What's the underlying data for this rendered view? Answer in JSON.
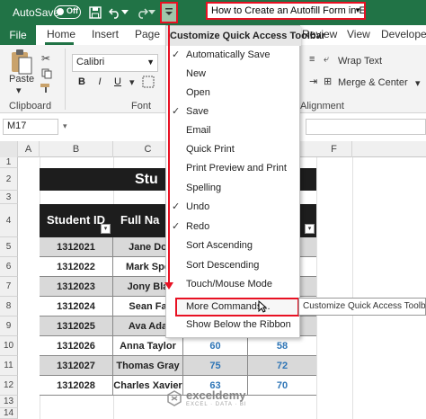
{
  "titlebar": {
    "autosave_label": "AutoSave",
    "autosave_state": "Off",
    "document_title": "How to Create an Autofill Form in Excel",
    "colors": {
      "excel_green": "#217346",
      "highlight_red": "#e81123"
    },
    "icons": [
      "save-icon",
      "undo-icon",
      "redo-icon",
      "customize-qat-icon"
    ]
  },
  "tabs": [
    "File",
    "Home",
    "Insert",
    "Page",
    "Review",
    "View",
    "Developer"
  ],
  "ribbon": {
    "paste_label": "Paste",
    "clipboard_label": "Clipboard",
    "font_name": "Calibri",
    "font_group_label": "Font",
    "bold": "B",
    "italic": "I",
    "underline": "U",
    "wrap_text": "Wrap Text",
    "merge_center": "Merge & Center",
    "alignment_label": "Alignment"
  },
  "formula_bar": {
    "name_box": "M17"
  },
  "grid": {
    "columns": [
      "A",
      "B",
      "C",
      "F"
    ],
    "rows": [
      "1",
      "2",
      "3",
      "4",
      "5",
      "6",
      "7",
      "8",
      "9",
      "10",
      "11",
      "12",
      "13",
      "14"
    ]
  },
  "table": {
    "banner": "Stu",
    "headers": [
      "Student ID",
      "Full Na"
    ],
    "rows": [
      {
        "id": "1312021",
        "name": "Jane Do",
        "s1": "",
        "s2": ""
      },
      {
        "id": "1312022",
        "name": "Mark Spe",
        "s1": "",
        "s2": ""
      },
      {
        "id": "1312023",
        "name": "Jony Bla",
        "s1": "",
        "s2": ""
      },
      {
        "id": "1312024",
        "name": "Sean Fa",
        "s1": "",
        "s2": ""
      },
      {
        "id": "1312025",
        "name": "Ava Ada",
        "s1": "",
        "s2": ""
      },
      {
        "id": "1312026",
        "name": "Anna Taylor",
        "s1": "60",
        "s2": "58"
      },
      {
        "id": "1312027",
        "name": "Thomas Gray",
        "s1": "75",
        "s2": "72"
      },
      {
        "id": "1312028",
        "name": "Charles Xavier",
        "s1": "63",
        "s2": "70"
      }
    ]
  },
  "menu": {
    "title": "Customize Quick Access Toolbar",
    "items": [
      {
        "label": "Automatically Save",
        "checked": true
      },
      {
        "label": "New",
        "checked": false
      },
      {
        "label": "Open",
        "checked": false
      },
      {
        "label": "Save",
        "checked": true
      },
      {
        "label": "Email",
        "checked": false
      },
      {
        "label": "Quick Print",
        "checked": false
      },
      {
        "label": "Print Preview and Print",
        "checked": false
      },
      {
        "label": "Spelling",
        "checked": false
      },
      {
        "label": "Undo",
        "checked": true
      },
      {
        "label": "Redo",
        "checked": true
      },
      {
        "label": "Sort Ascending",
        "checked": false
      },
      {
        "label": "Sort Descending",
        "checked": false
      },
      {
        "label": "Touch/Mouse Mode",
        "checked": false
      },
      {
        "label": "More Commands...",
        "checked": false
      },
      {
        "label": "Show Below the Ribbon",
        "checked": false
      }
    ],
    "check_glyph": "✓"
  },
  "tooltip": "Customize Quick Access Toolbar",
  "watermark": {
    "name": "exceldemy",
    "tagline": "EXCEL · DATA · BI"
  }
}
